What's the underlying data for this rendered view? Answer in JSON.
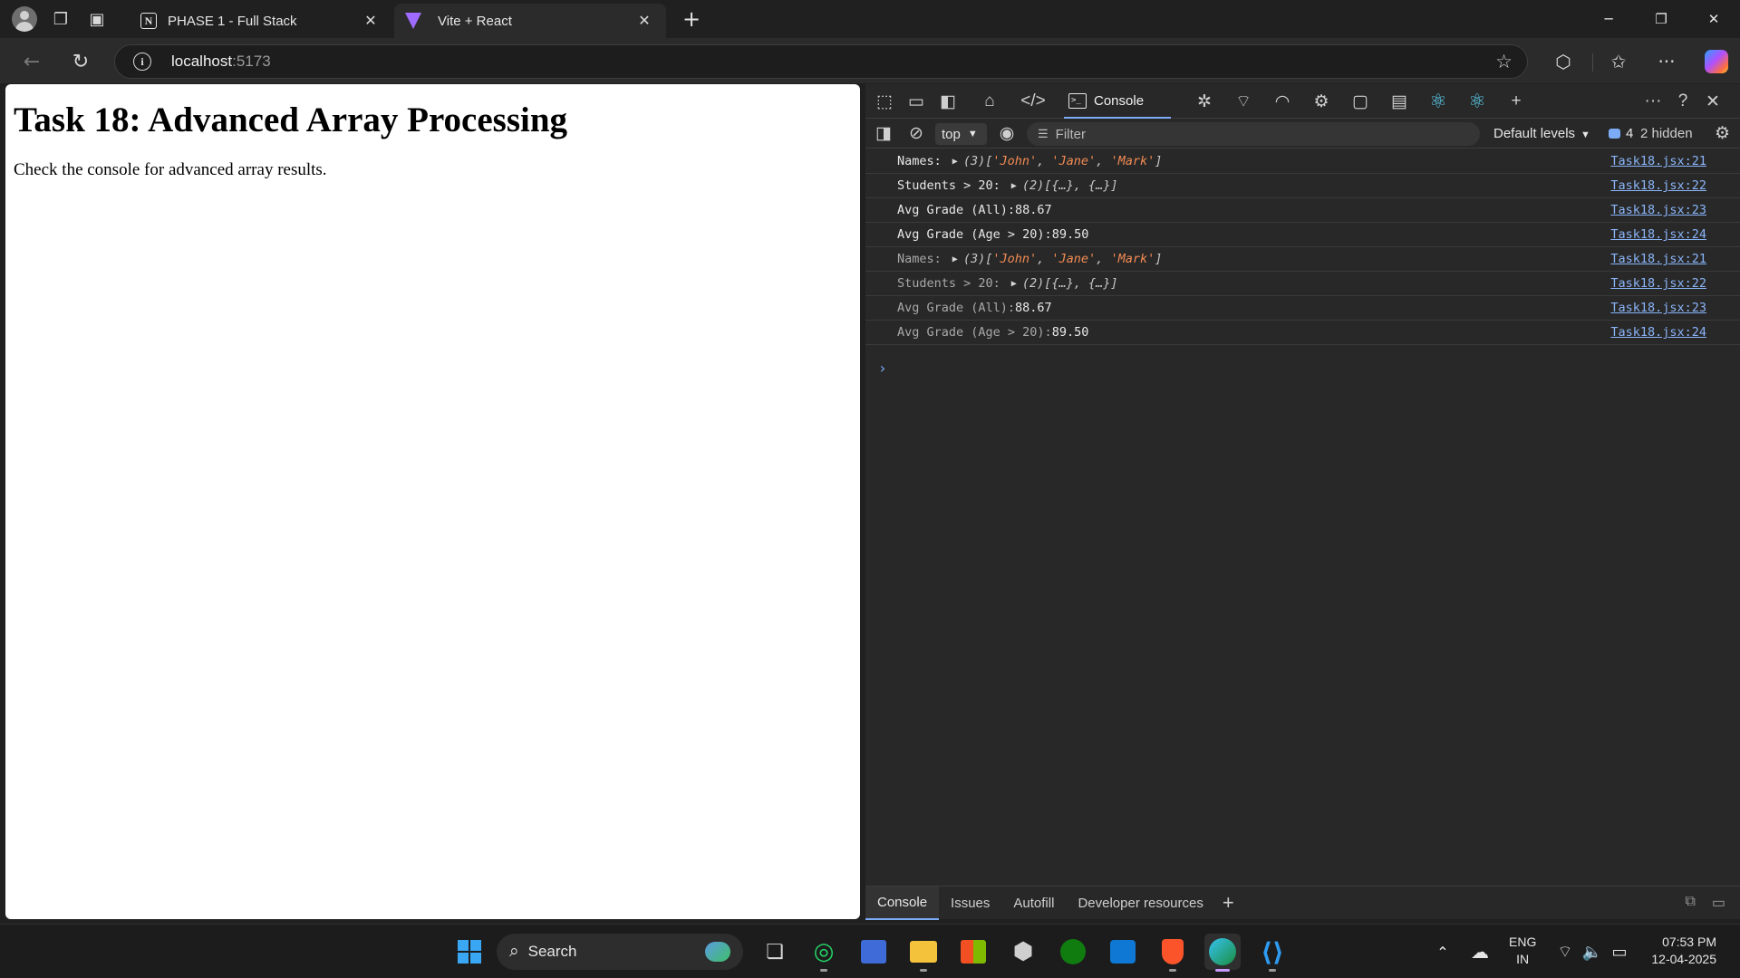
{
  "browser": {
    "tabs": [
      {
        "title": "PHASE 1 - Full Stack",
        "favicon": "notion-icon"
      },
      {
        "title": "Vite + React",
        "favicon": "vite-icon",
        "active": true
      }
    ],
    "address": {
      "host": "localhost",
      "port": ":5173"
    }
  },
  "page": {
    "heading": "Task 18: Advanced Array Processing",
    "text": "Check the console for advanced array results."
  },
  "devtools": {
    "console_tab": "Console",
    "context": "top",
    "filter_placeholder": "Filter",
    "levels": "Default levels",
    "issues_count": "4",
    "hidden": "2 hidden",
    "drawer_tabs": [
      "Console",
      "Issues",
      "Autofill",
      "Developer resources"
    ],
    "logs": [
      {
        "label": "Names:",
        "count": "(3)",
        "items": [
          "'John'",
          "'Jane'",
          "'Mark'"
        ],
        "source": "Task18.jsx:21",
        "dim": false
      },
      {
        "label": "Students > 20:",
        "count": "(2)",
        "value": "[{…}, {…}]",
        "source": "Task18.jsx:22",
        "dim": false
      },
      {
        "label": "Avg Grade (All):",
        "value": "88.67",
        "source": "Task18.jsx:23",
        "dim": false
      },
      {
        "label": "Avg Grade (Age > 20):",
        "value": "89.50",
        "source": "Task18.jsx:24",
        "dim": false
      },
      {
        "label": "Names:",
        "count": "(3)",
        "items": [
          "'John'",
          "'Jane'",
          "'Mark'"
        ],
        "source": "Task18.jsx:21",
        "dim": true
      },
      {
        "label": "Students > 20:",
        "count": "(2)",
        "value": "[{…}, {…}]",
        "source": "Task18.jsx:22",
        "dim": true
      },
      {
        "label": "Avg Grade (All):",
        "value": "88.67",
        "source": "Task18.jsx:23",
        "dim": true
      },
      {
        "label": "Avg Grade (Age > 20):",
        "value": "89.50",
        "source": "Task18.jsx:24",
        "dim": true
      }
    ]
  },
  "taskbar": {
    "search_label": "Search",
    "lang_top": "ENG",
    "lang_bottom": "IN",
    "time": "07:53 PM",
    "date": "12-04-2025"
  },
  "colors": {
    "accent": "#7cacf8",
    "string": "#f28b54",
    "link": "#8ab4f8"
  }
}
